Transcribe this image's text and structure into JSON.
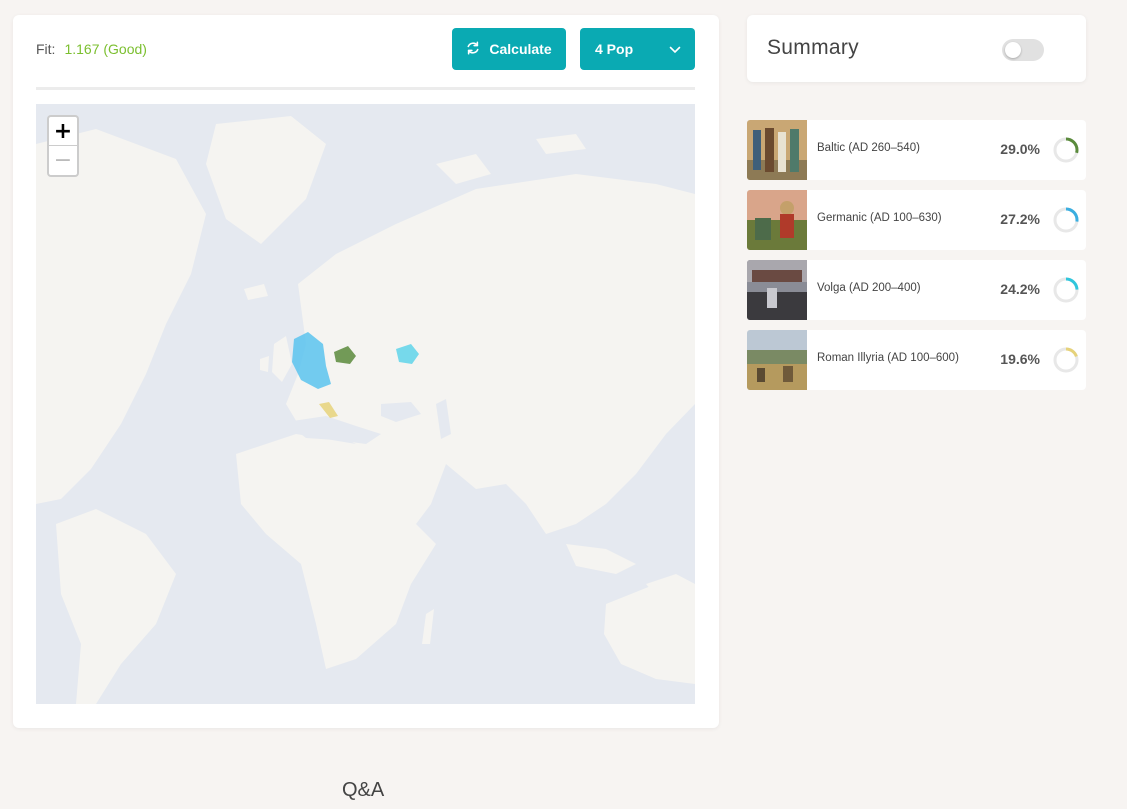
{
  "fit": {
    "label": "Fit:",
    "value": "1.167 (Good)",
    "value_color": "#7bbf2f"
  },
  "toolbar": {
    "calculate_label": "Calculate",
    "calculate_icon": "refresh-icon",
    "pop_label": "4 Pop",
    "pop_icon": "chevron-down-icon",
    "button_color": "#0aaab3"
  },
  "map": {
    "zoom_in_label": "+",
    "zoom_out_label": "−",
    "ocean_color": "#e5e9f0",
    "land_color": "#f5f4f1"
  },
  "summary": {
    "title": "Summary",
    "toggle_on": false
  },
  "populations": [
    {
      "name": "Baltic (AD 260–540)",
      "percent": "29.0%",
      "fraction": 0.29,
      "color": "#5a8a3c",
      "thumb": "baltic-thumbnail"
    },
    {
      "name": "Germanic (AD 100–630)",
      "percent": "27.2%",
      "fraction": 0.272,
      "color": "#3aaee0",
      "thumb": "germanic-thumbnail"
    },
    {
      "name": "Volga (AD 200–400)",
      "percent": "24.2%",
      "fraction": 0.242,
      "color": "#2fc6dc",
      "thumb": "volga-thumbnail"
    },
    {
      "name": "Roman Illyria (AD 100–600)",
      "percent": "19.6%",
      "fraction": 0.196,
      "color": "#e6d27a",
      "thumb": "roman-illyria-thumbnail"
    }
  ],
  "footer": {
    "qa_label": "Q&A"
  }
}
